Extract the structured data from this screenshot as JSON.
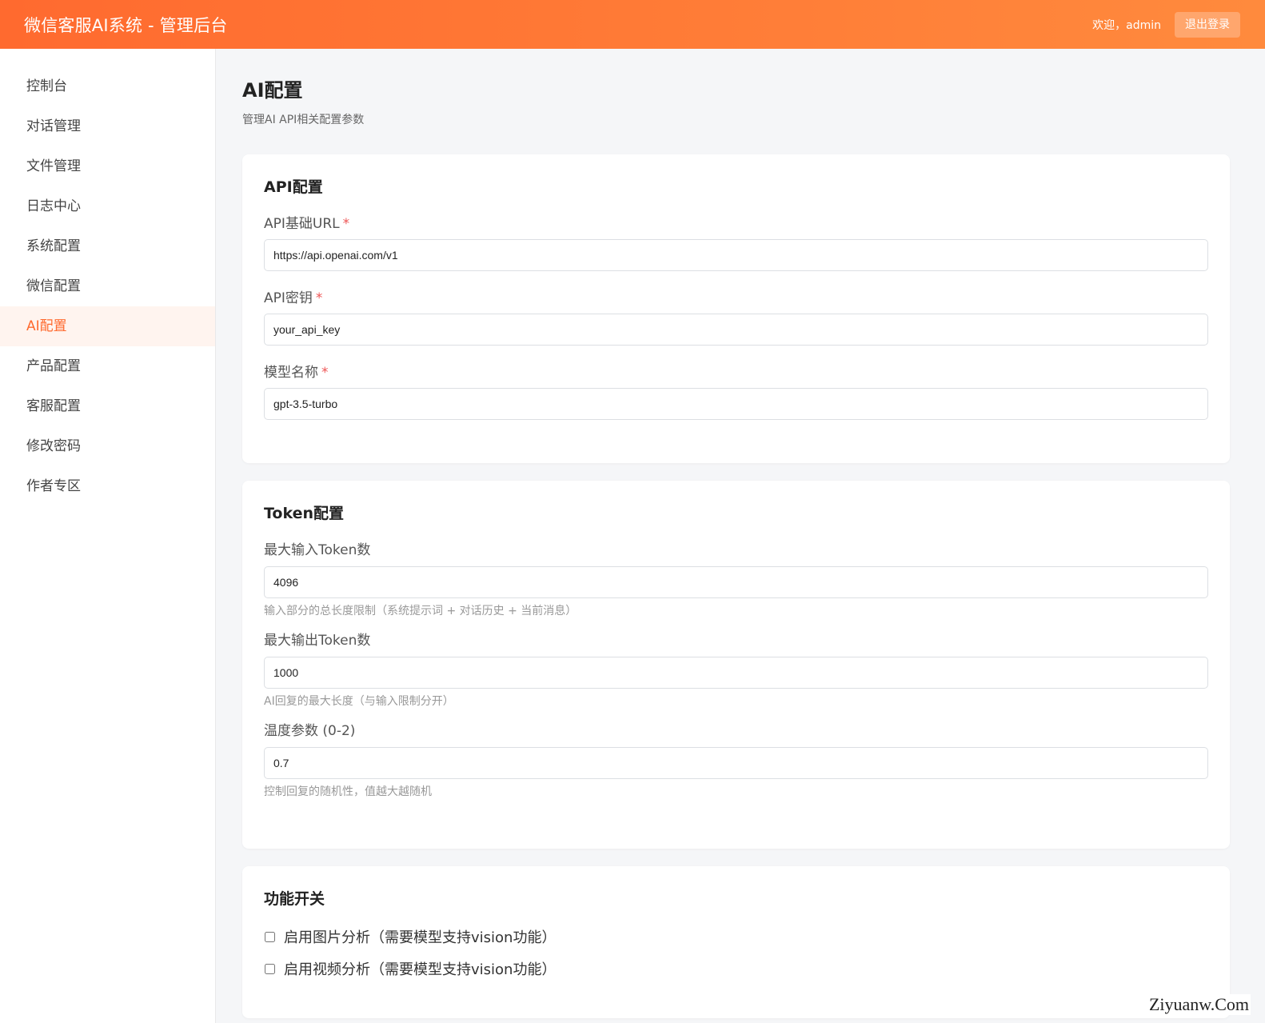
{
  "header": {
    "title": "微信客服AI系统 - 管理后台",
    "welcome": "欢迎，admin",
    "logout_label": "退出登录"
  },
  "sidebar": {
    "items": [
      {
        "label": "控制台"
      },
      {
        "label": "对话管理"
      },
      {
        "label": "文件管理"
      },
      {
        "label": "日志中心"
      },
      {
        "label": "系统配置"
      },
      {
        "label": "微信配置"
      },
      {
        "label": "AI配置",
        "active": true
      },
      {
        "label": "产品配置"
      },
      {
        "label": "客服配置"
      },
      {
        "label": "修改密码"
      },
      {
        "label": "作者专区"
      }
    ]
  },
  "page": {
    "title": "AI配置",
    "subtitle": "管理AI API相关配置参数"
  },
  "api_card": {
    "title": "API配置",
    "base_url": {
      "label": "API基础URL",
      "required_mark": "*",
      "value": "https://api.openai.com/v1"
    },
    "api_key": {
      "label": "API密钥",
      "required_mark": "*",
      "value": "your_api_key"
    },
    "model": {
      "label": "模型名称",
      "required_mark": "*",
      "value": "gpt-3.5-turbo"
    }
  },
  "token_card": {
    "title": "Token配置",
    "max_input": {
      "label": "最大输入Token数",
      "value": "4096",
      "hint": "输入部分的总长度限制（系统提示词 + 对话历史 + 当前消息）"
    },
    "max_output": {
      "label": "最大输出Token数",
      "value": "1000",
      "hint": "AI回复的最大长度（与输入限制分开）"
    },
    "temperature": {
      "label": "温度参数 (0-2)",
      "value": "0.7",
      "hint": "控制回复的随机性，值越大越随机"
    }
  },
  "feature_card": {
    "title": "功能开关",
    "image_analysis": {
      "label": "启用图片分析（需要模型支持vision功能）",
      "checked": false
    },
    "video_analysis": {
      "label": "启用视频分析（需要模型支持vision功能）",
      "checked": false
    }
  },
  "watermark": "Ziyuanw.Com",
  "colors": {
    "accent": "#ff6a2f",
    "accent_bg": "#fff4ef",
    "required": "#e55555"
  }
}
